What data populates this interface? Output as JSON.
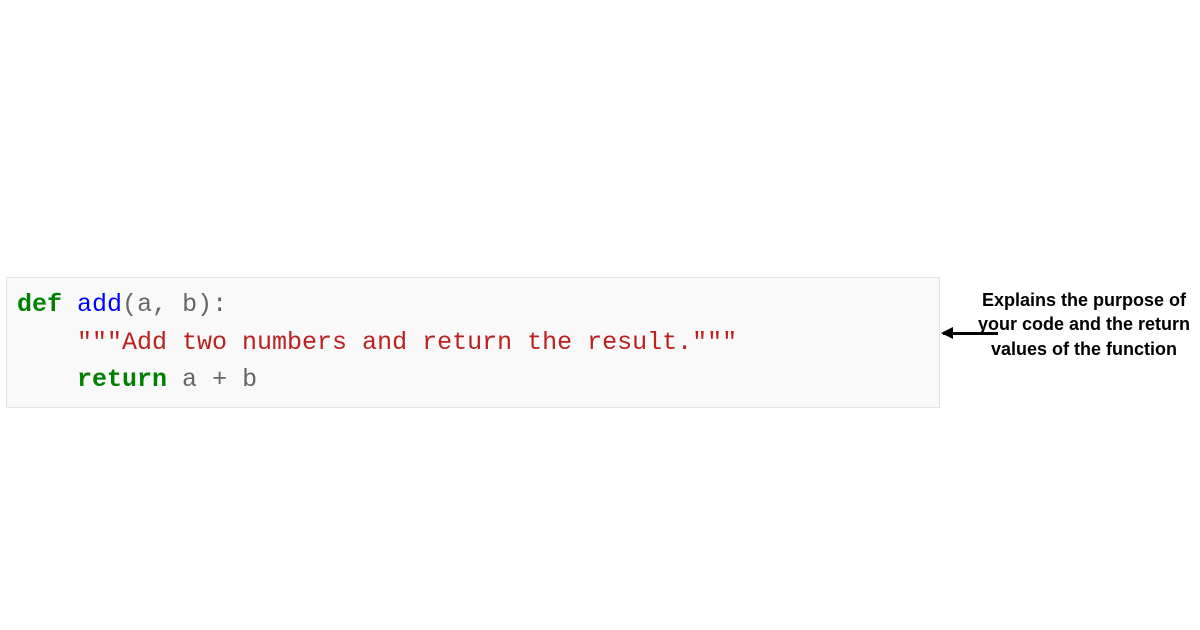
{
  "code": {
    "def_keyword": "def",
    "func_name": "add",
    "open_paren": "(",
    "params": "a, b",
    "close_paren": ")",
    "colon": ":",
    "docstring": "\"\"\"Add two numbers and return the result.\"\"\"",
    "return_keyword": "return",
    "var_a": "a",
    "plus": "+",
    "var_b": "b",
    "indent": "    ",
    "space": " "
  },
  "annotation": {
    "text": "Explains the purpose of your code and the return values of the function"
  }
}
